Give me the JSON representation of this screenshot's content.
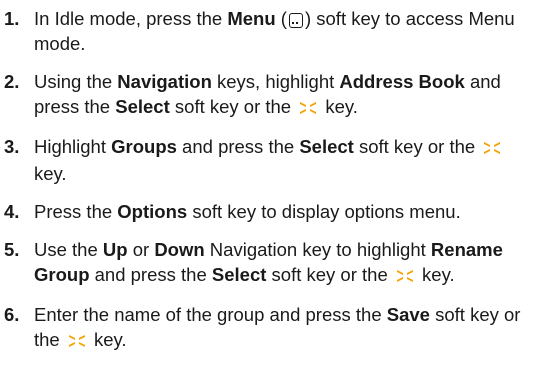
{
  "steps": [
    {
      "number": "1.",
      "parts": [
        {
          "t": "In Idle mode, press the "
        },
        {
          "t": "Menu",
          "b": true
        },
        {
          "t": " ("
        },
        {
          "icon": "menu-softkey-icon"
        },
        {
          "t": ") soft key to access Menu mode."
        }
      ]
    },
    {
      "number": "2.",
      "parts": [
        {
          "t": "Using the "
        },
        {
          "t": "Navigation",
          "b": true
        },
        {
          "t": " keys, highlight "
        },
        {
          "t": "Address Book",
          "b": true
        },
        {
          "t": " and press the "
        },
        {
          "t": "Select",
          "b": true
        },
        {
          "t": " soft key or the "
        },
        {
          "icon": "navigation-key-icon"
        },
        {
          "t": " key."
        }
      ]
    },
    {
      "number": "3.",
      "parts": [
        {
          "t": "Highlight "
        },
        {
          "t": "Groups",
          "b": true
        },
        {
          "t": " and press the "
        },
        {
          "t": "Select",
          "b": true
        },
        {
          "t": " soft key or the "
        },
        {
          "icon": "navigation-key-icon"
        },
        {
          "t": " key."
        }
      ]
    },
    {
      "number": "4.",
      "parts": [
        {
          "t": "Press the "
        },
        {
          "t": "Options",
          "b": true
        },
        {
          "t": " soft key to display options menu."
        }
      ]
    },
    {
      "number": "5.",
      "parts": [
        {
          "t": "Use the "
        },
        {
          "t": "Up",
          "b": true
        },
        {
          "t": " or "
        },
        {
          "t": "Down",
          "b": true
        },
        {
          "t": " Navigation key to highlight "
        },
        {
          "t": "Rename Group",
          "b": true
        },
        {
          "t": " and press the "
        },
        {
          "t": "Select",
          "b": true
        },
        {
          "t": " soft key or the "
        },
        {
          "icon": "navigation-key-icon"
        },
        {
          "t": " key."
        }
      ]
    },
    {
      "number": "6.",
      "parts": [
        {
          "t": "Enter the name of the group and press the "
        },
        {
          "t": "Save",
          "b": true
        },
        {
          "t": " soft key or the "
        },
        {
          "icon": "navigation-key-icon"
        },
        {
          "t": " key."
        }
      ]
    }
  ],
  "colors": {
    "text": "#1a1a1a",
    "nav_key_icon": "#f5a300"
  }
}
